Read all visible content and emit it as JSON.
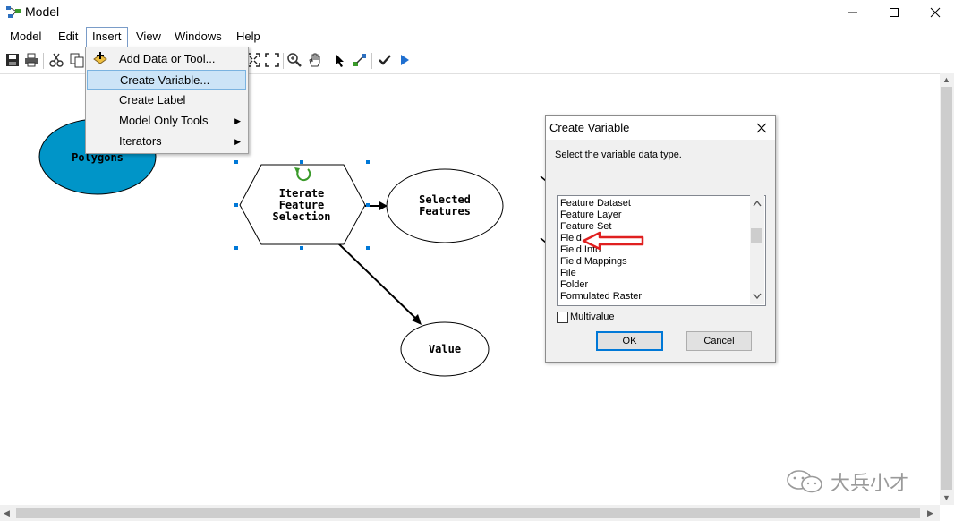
{
  "window": {
    "title": "Model",
    "controls": {
      "minimize": "minimize-icon",
      "maximize": "maximize-icon",
      "close": "close-icon"
    }
  },
  "menubar": {
    "items": [
      "Model",
      "Edit",
      "Insert",
      "View",
      "Windows",
      "Help"
    ],
    "active": "Insert"
  },
  "toolbar": {
    "icons": [
      "save-icon",
      "print-icon",
      "cut-icon",
      "copy-icon",
      "add-data-icon",
      "full-extent-icon",
      "zoom-in-icon",
      "pan-icon",
      "select-icon",
      "connect-icon",
      "validate-icon",
      "run-icon"
    ]
  },
  "insert_menu": {
    "items": [
      {
        "label": "Add Data or Tool...",
        "icon": "add-data-icon",
        "submenu": false
      },
      {
        "label": "Create Variable...",
        "submenu": false,
        "highlighted": true
      },
      {
        "label": "Create Label",
        "submenu": false
      },
      {
        "label": "Model Only Tools",
        "submenu": true
      },
      {
        "label": "Iterators",
        "submenu": true
      }
    ]
  },
  "model": {
    "nodes": {
      "polygons": "Polygons",
      "iterate_line1": "Iterate",
      "iterate_line2": "Feature",
      "iterate_line3": "Selection",
      "selected_line1": "Selected",
      "selected_line2": "Features",
      "value": "Value"
    },
    "colors": {
      "data_fill": "#0095c8",
      "iterator_icon": "#3a9a2a",
      "selection_handle": "#0078d7"
    }
  },
  "dialog": {
    "title": "Create Variable",
    "prompt": "Select the variable data type.",
    "list_items": [
      "Feature Dataset",
      "Feature Layer",
      "Feature Set",
      "Field",
      "Field Info",
      "Field Mappings",
      "File",
      "Folder",
      "Formulated Raster"
    ],
    "pointed_item": "Field",
    "pointer_color": "#e02020",
    "multivalue_label": "Multivalue",
    "multivalue_checked": false,
    "ok_label": "OK",
    "cancel_label": "Cancel"
  },
  "watermark": {
    "text": "大兵小才",
    "icon": "wechat-icon"
  }
}
